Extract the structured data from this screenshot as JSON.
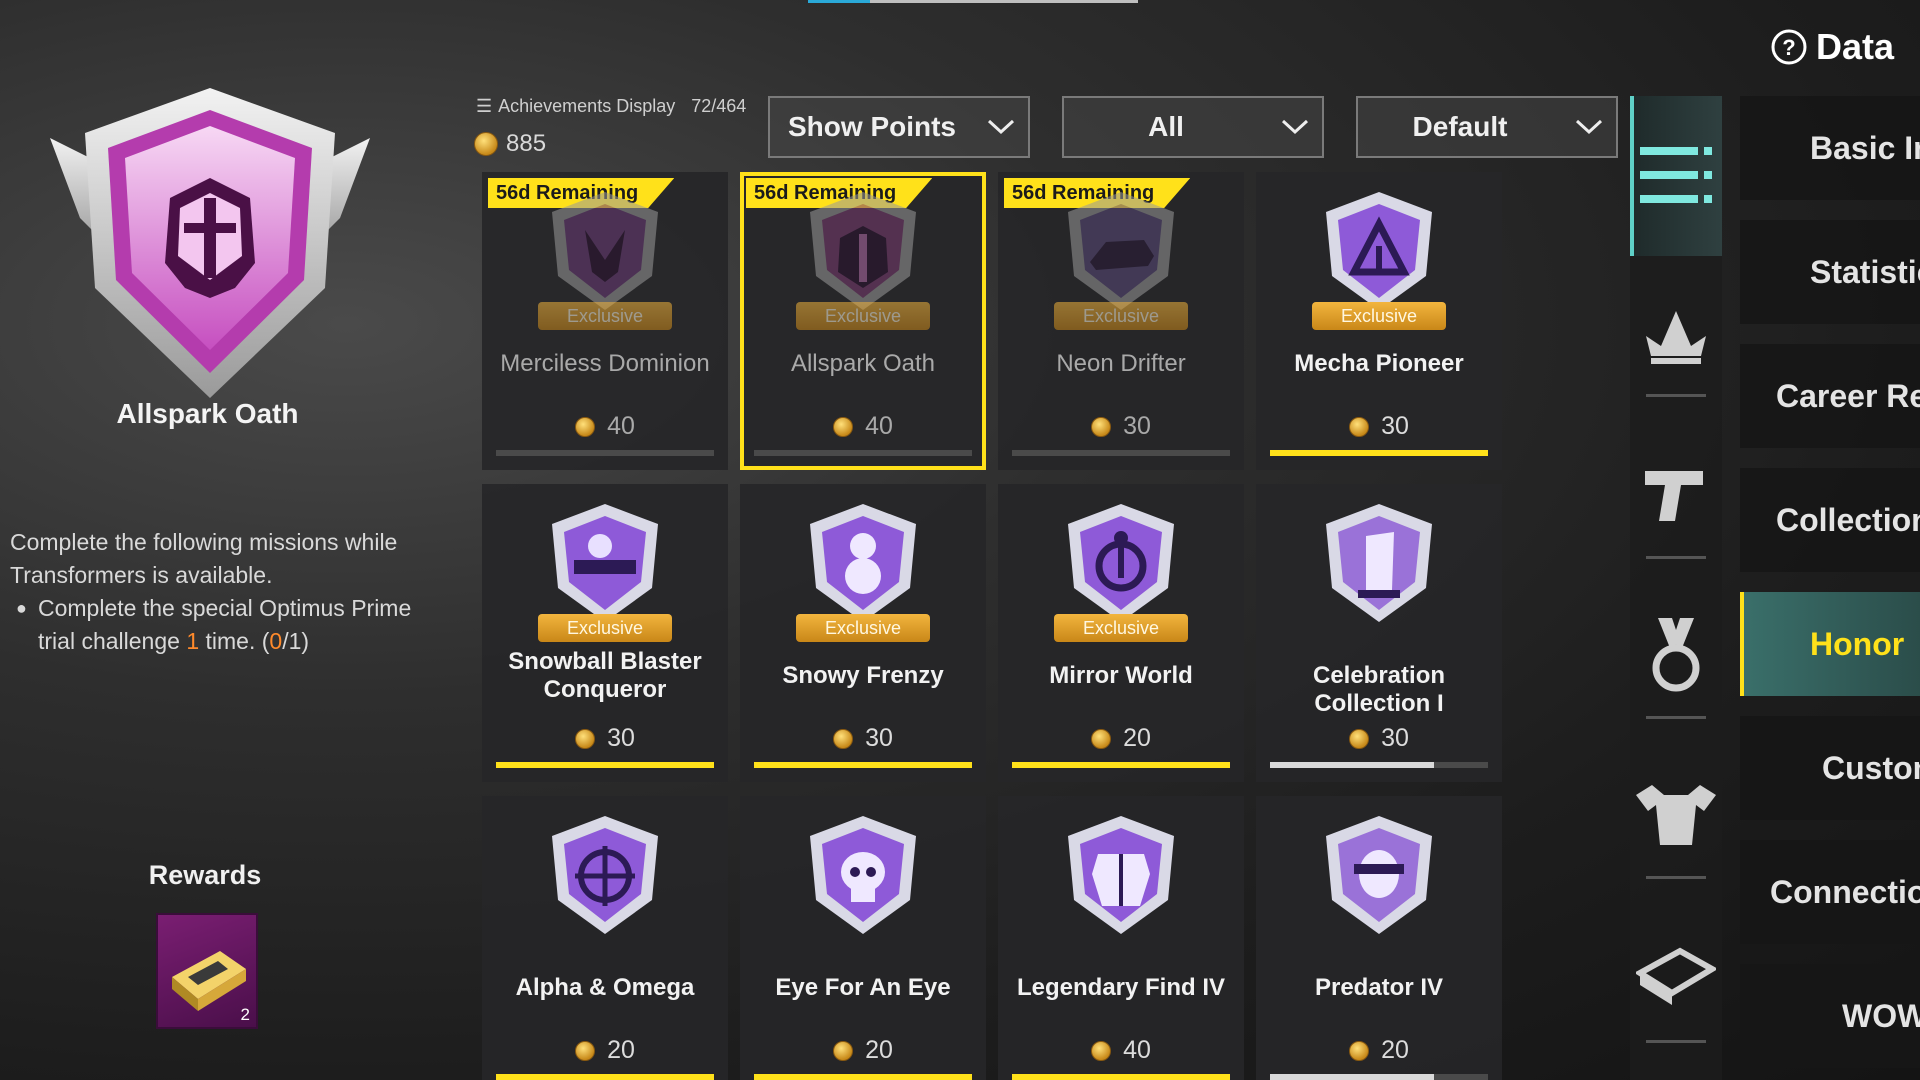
{
  "left_panel": {
    "title": "Allspark Oath",
    "desc_line1": "Complete the following missions while",
    "desc_line2": "Transformers is available.",
    "bullet_text_a": "Complete the special Optimus Prime",
    "bullet_text_b_pre": "trial challenge ",
    "bullet_count": "1",
    "bullet_text_b_mid": " time. (",
    "bullet_progress": "0",
    "bullet_text_b_end": "/1)",
    "rewards_title": "Rewards",
    "reward_qty": "2"
  },
  "header": {
    "achievements_label": "Achievements Display",
    "achievements_count": "72/464",
    "points": "885",
    "dropdown1": "Show Points",
    "dropdown2": "All",
    "dropdown3": "Default",
    "help_label": "Data"
  },
  "cards": [
    {
      "remaining": "56d Remaining",
      "exclusive": "Exclusive",
      "name": "Merciless Dominion",
      "points": "40",
      "progress": 0
    },
    {
      "remaining": "56d Remaining",
      "exclusive": "Exclusive",
      "name": "Allspark Oath",
      "points": "40",
      "progress": 0
    },
    {
      "remaining": "56d Remaining",
      "exclusive": "Exclusive",
      "name": "Neon Drifter",
      "points": "30",
      "progress": 0
    },
    {
      "exclusive": "Exclusive",
      "name": "Mecha Pioneer",
      "points": "30",
      "progress": 1
    },
    {
      "exclusive": "Exclusive",
      "name": "Snowball Blaster Conqueror",
      "points": "30",
      "progress": 1
    },
    {
      "exclusive": "Exclusive",
      "name": "Snowy Frenzy",
      "points": "30",
      "progress": 1
    },
    {
      "exclusive": "Exclusive",
      "name": "Mirror World",
      "points": "20",
      "progress": 1
    },
    {
      "name": "Celebration Collection I",
      "points": "30",
      "progress": 0.75
    },
    {
      "name": "Alpha & Omega",
      "points": "20",
      "progress": 1
    },
    {
      "name": "Eye For An Eye",
      "points": "20",
      "progress": 1
    },
    {
      "name": "Legendary Find IV",
      "points": "40",
      "progress": 1
    },
    {
      "name": "Predator IV",
      "points": "20",
      "progress": 0.75
    }
  ],
  "tabs": [
    {
      "label": "Basic Info"
    },
    {
      "label": "Statistics"
    },
    {
      "label": "Career Results"
    },
    {
      "label": "Collections"
    },
    {
      "label": "Honor"
    },
    {
      "label": "Customize"
    },
    {
      "label": "Connections"
    },
    {
      "label": "WOW"
    }
  ],
  "colors": {
    "accent_yellow": "#ffe11a",
    "exclusive_gold": "#e1a22b",
    "badge_purple": "#8e5ad8",
    "teal_active": "#3a6f6a"
  }
}
